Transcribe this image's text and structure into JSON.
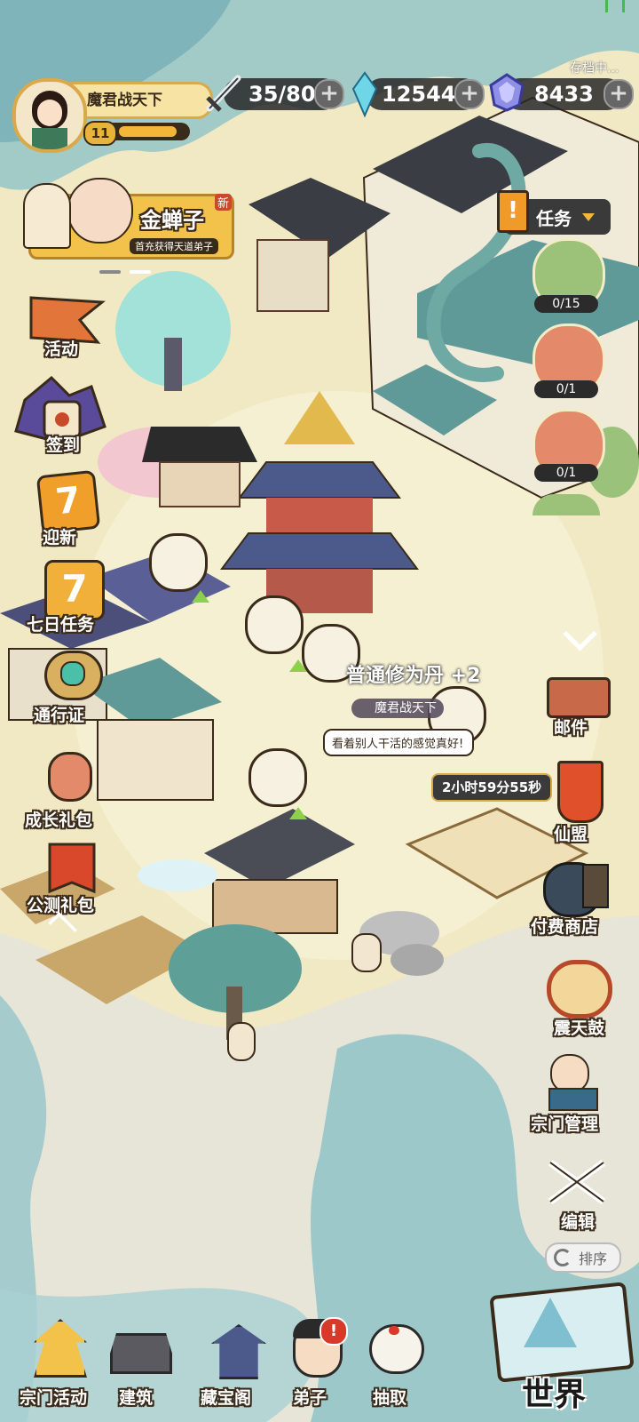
{
  "top": {
    "save_status": "存档中...",
    "player": {
      "name": "魔君战天下",
      "level": "11",
      "exp_fraction": 0.85
    },
    "stamina": {
      "value": "35/80"
    },
    "spirit_stone": {
      "value": "12544"
    },
    "gem": {
      "value": "8433"
    }
  },
  "promo": {
    "name": "金蝉子",
    "subtitle": "首充获得天道弟子",
    "badge": "新"
  },
  "left_menu": [
    {
      "label": "活动"
    },
    {
      "label": "签到"
    },
    {
      "label": "迎新"
    },
    {
      "label": "七日任务"
    },
    {
      "label": "通行证"
    },
    {
      "label": "成长礼包"
    },
    {
      "label": "公测礼包"
    }
  ],
  "quests": {
    "title": "任务",
    "items": [
      {
        "count": "0/15"
      },
      {
        "count": "0/1"
      },
      {
        "count": "0/1"
      }
    ]
  },
  "right_menu": [
    {
      "label": "邮件"
    },
    {
      "label": "仙盟"
    },
    {
      "label": "付费商店"
    },
    {
      "label": "震天鼓"
    },
    {
      "label": "宗门管理"
    },
    {
      "label": "编辑"
    }
  ],
  "sort_button": "排序",
  "map": {
    "reward_text": "普通修为丹 +2",
    "npc_name": "魔君战天下",
    "speech": "看着别人干活的感觉真好!",
    "timer": "2小时59分55秒"
  },
  "bottom_nav": [
    {
      "label": "宗门活动"
    },
    {
      "label": "建筑"
    },
    {
      "label": "藏宝阁"
    },
    {
      "label": "弟子"
    },
    {
      "label": "抽取"
    }
  ],
  "world_button": "世界",
  "colors": {
    "gold": "#f2c24a",
    "teal": "#7fbfb0",
    "bg": "#f3ecc8"
  }
}
